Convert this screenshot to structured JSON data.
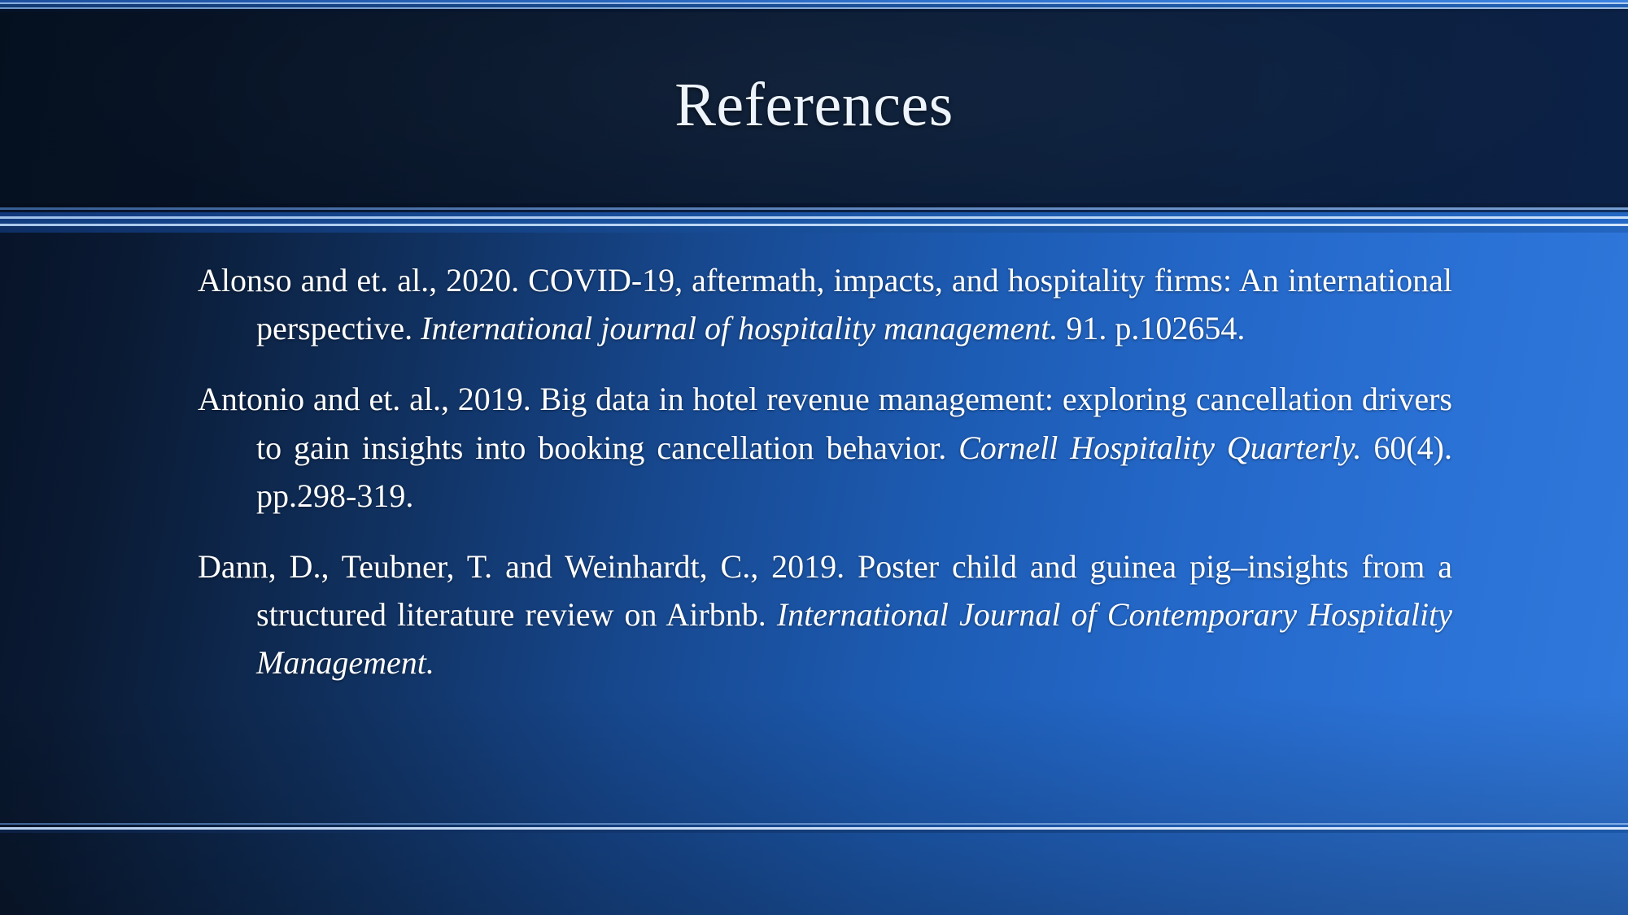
{
  "slide": {
    "title": "References",
    "theme": {
      "title_band_color": "#081a33",
      "body_gradient_start": "#071226",
      "body_gradient_end": "#3179dc",
      "text_color": "#ffffff",
      "rule_highlight_color": "#c0daf7"
    }
  },
  "references": [
    {
      "id": "ref-alonso-2020",
      "authors_year": "Alonso and et. al., 2020.",
      "title": "COVID-19, aftermath, impacts, and hospitality firms: An international perspective.",
      "source": "International journal of hospitality management.",
      "volume": "91.",
      "pages": "p.102654.",
      "segments": [
        {
          "style": "normal",
          "text": "Alonso and et. al., 2020. COVID-19, aftermath, impacts, and hospitality firms: An international perspective. "
        },
        {
          "style": "italic",
          "text": "International journal of hospitality management."
        },
        {
          "style": "normal",
          "text": "  91. p.102654."
        }
      ]
    },
    {
      "id": "ref-antonio-2019",
      "authors_year": "Antonio and et. al., 2019.",
      "title": "Big data in hotel revenue management: exploring cancellation drivers to gain insights into booking cancellation behavior.",
      "source": "Cornell Hospitality Quarterly.",
      "volume": "60(4).",
      "pages": "pp.298-319.",
      "segments": [
        {
          "style": "normal",
          "text": "Antonio and et. al., 2019. Big data in hotel revenue management: exploring cancellation drivers to gain insights into booking cancellation behavior. "
        },
        {
          "style": "italic",
          "text": "Cornell Hospitality Quarterly."
        },
        {
          "style": "normal",
          "text": "  60(4). pp.298-319."
        }
      ]
    },
    {
      "id": "ref-dann-2019",
      "authors_year": "Dann, D., Teubner, T. and Weinhardt, C., 2019.",
      "title": "Poster child and guinea pig–insights from a structured literature review on Airbnb.",
      "source": "International Journal of Contemporary Hospitality Management.",
      "volume": "",
      "pages": "",
      "segments": [
        {
          "style": "normal",
          "text": "Dann, D., Teubner, T. and Weinhardt, C., 2019. Poster child and guinea pig–insights from a structured literature review on Airbnb. "
        },
        {
          "style": "italic",
          "text": "International Journal of Contemporary Hospitality Management."
        }
      ]
    }
  ]
}
